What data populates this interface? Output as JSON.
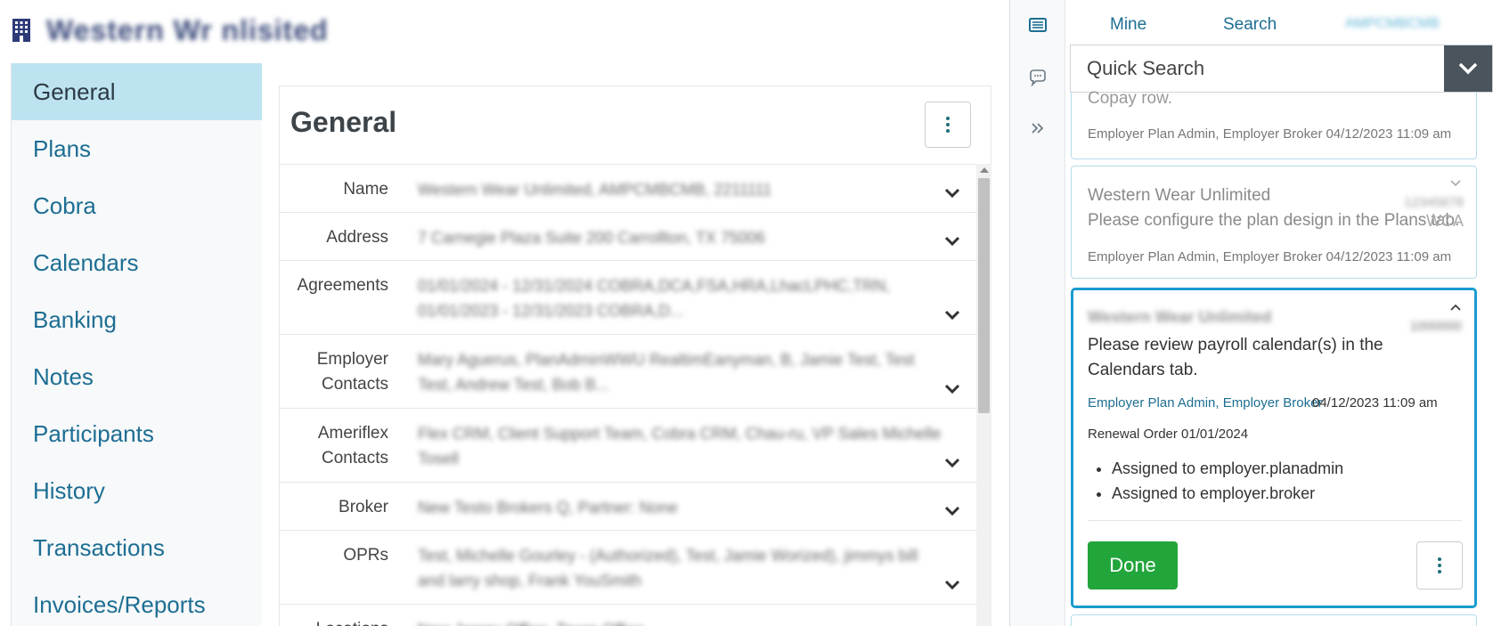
{
  "header": {
    "company_name": "Western Wr nlisited",
    "icon": "building-icon"
  },
  "sidebar": {
    "items": [
      {
        "label": "General",
        "active": true
      },
      {
        "label": "Plans"
      },
      {
        "label": "Cobra"
      },
      {
        "label": "Calendars"
      },
      {
        "label": "Banking"
      },
      {
        "label": "Notes"
      },
      {
        "label": "Participants"
      },
      {
        "label": "History"
      },
      {
        "label": "Transactions"
      },
      {
        "label": "Invoices/Reports"
      }
    ]
  },
  "main": {
    "title": "General",
    "rows": [
      {
        "label": "Name",
        "value": "Western Wear Unlimited, AMPCMBCMB, 2211111"
      },
      {
        "label": "Address",
        "value": "7 Carnegie Plaza Suite 200 Carrollton, TX 75006"
      },
      {
        "label": "Agreements",
        "value": "01/01/2024 - 12/31/2024 COBRA,DCA,FSA,HRA,LhacLPHC,TRN, 01/01/2023 - 12/31/2023 COBRA,D..."
      },
      {
        "label": "Employer Contacts",
        "value": "Mary Aguerus, PlanAdminWWU RealtimEanyman, B, Jamie Test, Test Test, Andrew Test, Bob B..."
      },
      {
        "label": "Ameriflex Contacts",
        "value": "Flex CRM, Client Support Team, Cobra CRM, Chau-ru, VP Sales Michelle Tosell"
      },
      {
        "label": "Broker",
        "value": "New Testo Brokers Q, Partner: None"
      },
      {
        "label": "OPRs",
        "value": "Test, Michelle Gourley - (Authorized), Test, Jamie Worized), jimmys bill and larry shop, Frank YouSmith"
      },
      {
        "label": "Locations",
        "value": "New Jersey Office, Texas Office"
      }
    ]
  },
  "rail": {
    "icons": [
      "list-icon",
      "chat-icon",
      "double-chevron-right-icon"
    ]
  },
  "right": {
    "tabs": {
      "mine": "Mine",
      "search": "Search",
      "other": "AMPCMBCMB"
    },
    "quick_search": {
      "placeholder": "Quick Search"
    },
    "cards": [
      {
        "text_partial": "Copay row.",
        "roles": "Employer Plan Admin, Employer Broker",
        "date": "04/12/2023 11:09 am"
      },
      {
        "title": "Western Wear Unlimited",
        "message": "Please configure the plan design in the Plans tab.",
        "code": "WCA",
        "code_blur": "12345678",
        "roles": "Employer Plan Admin, Employer Broker",
        "date": "04/12/2023 11:09 am"
      },
      {
        "title": "Western Wear Unlimited",
        "code_blur": "1000000",
        "message": "Please review payroll calendar(s) in the Calendars tab.",
        "roles": "Employer Plan Admin, Employer Broker",
        "date": "04/12/2023 11:09 am",
        "order": "Renewal Order 01/01/2024",
        "assignments": [
          "Assigned to employer.planadmin",
          "Assigned to employer.broker"
        ],
        "done_label": "Done"
      }
    ]
  },
  "colors": {
    "accent": "#1d6e93",
    "active_nav": "#bde3f0",
    "done": "#22a53b",
    "active_card_border": "#1a9bd0"
  }
}
